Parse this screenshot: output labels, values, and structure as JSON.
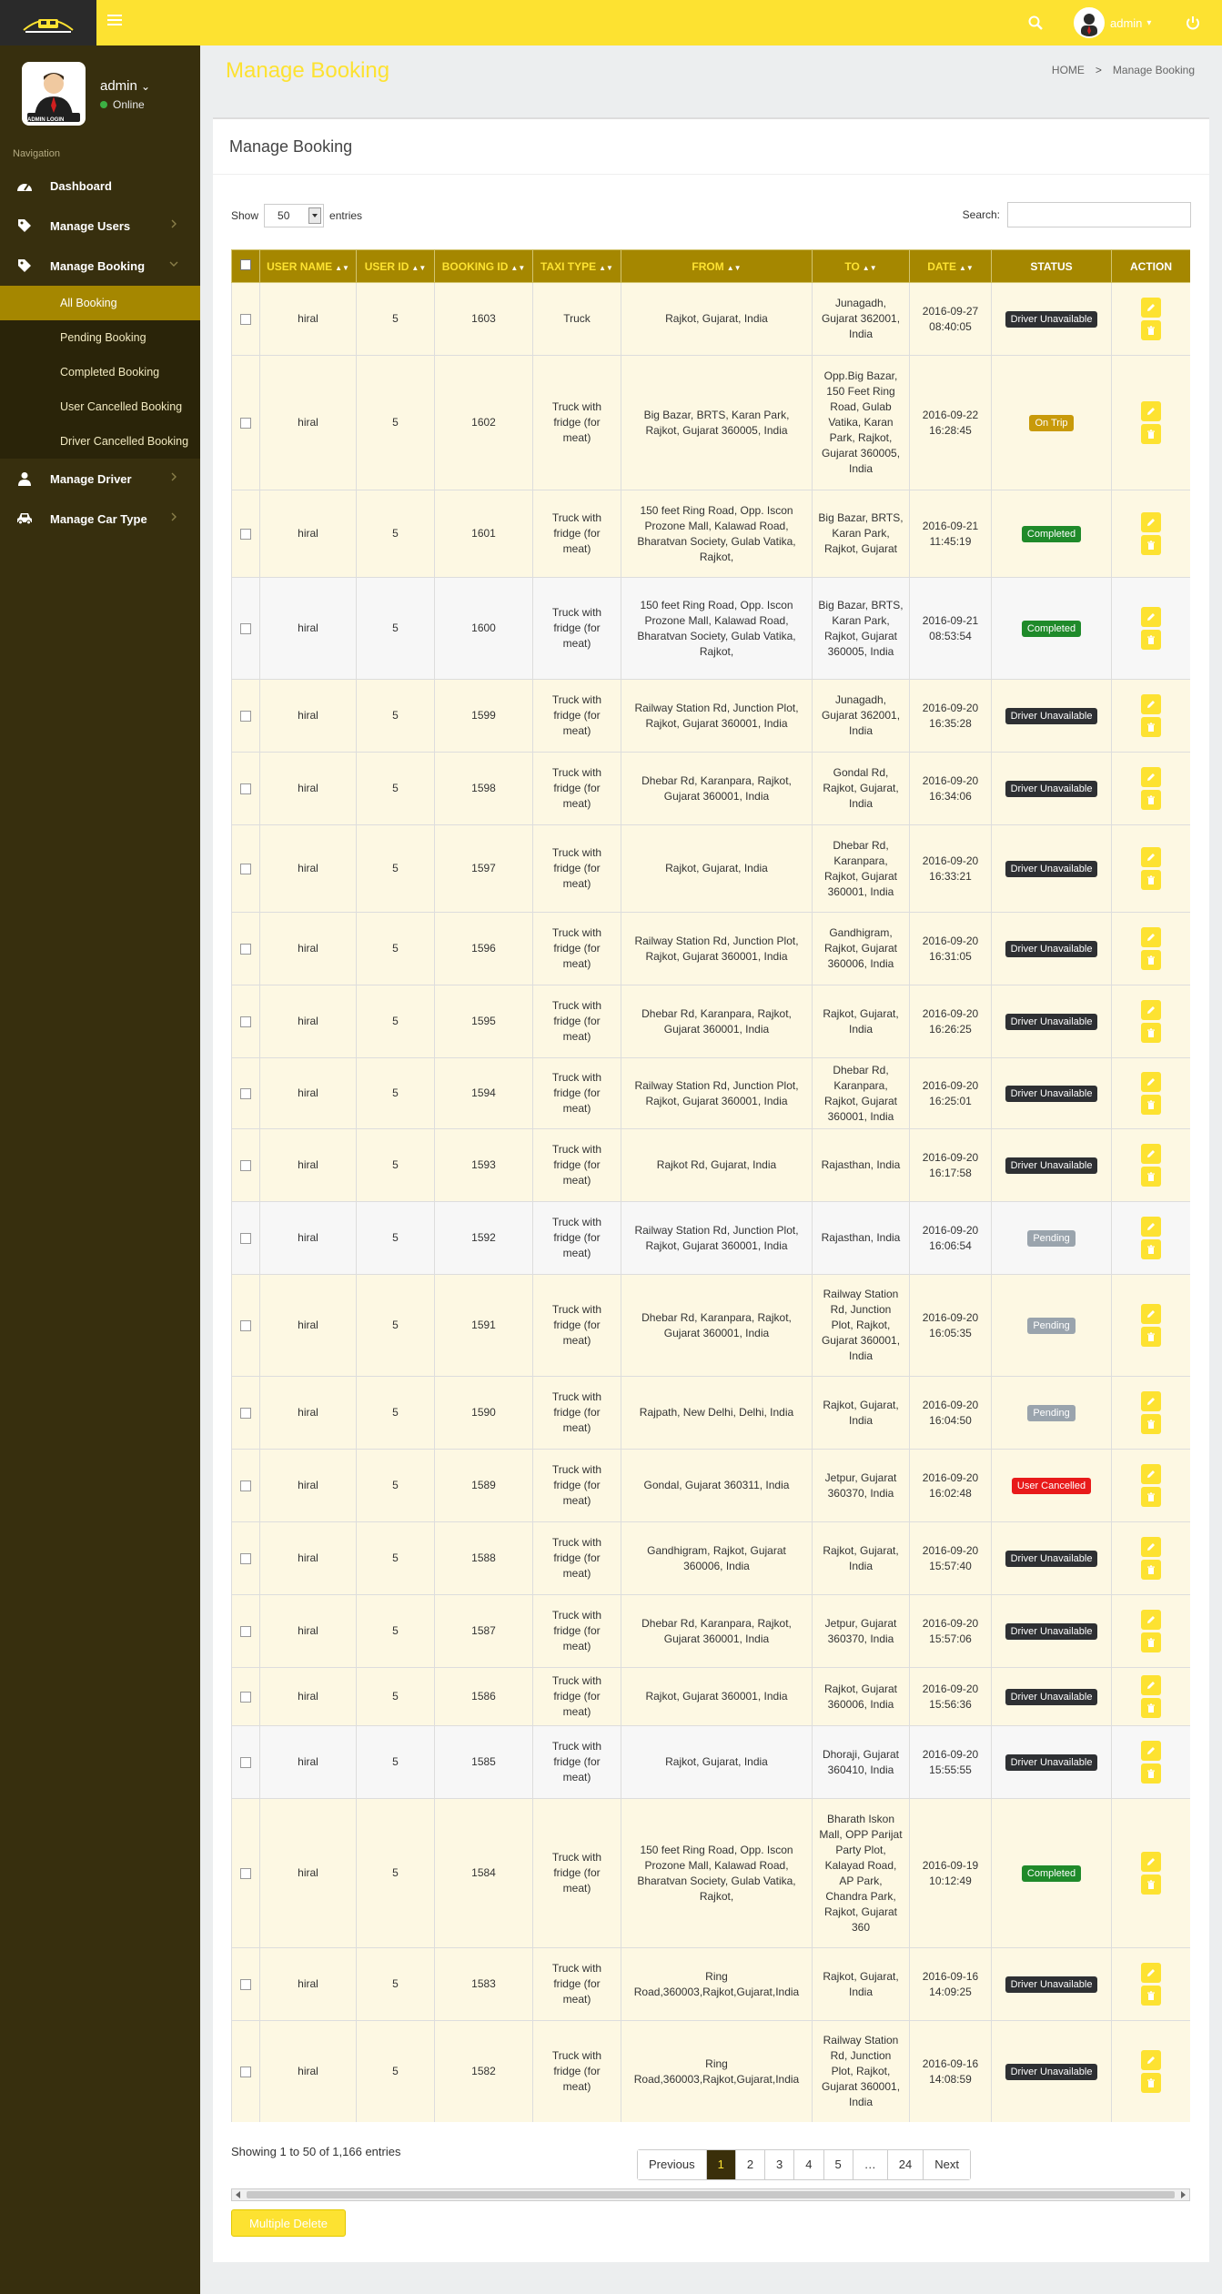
{
  "topbar": {
    "user_label": "admin",
    "user_caret": "▾"
  },
  "sidebar": {
    "profile_name": "admin",
    "profile_caret": "⌄",
    "profile_status": "Online",
    "badge_text": "ADMIN LOGIN",
    "nav_heading": "Navigation",
    "items": [
      {
        "label": "Dashboard",
        "icon": "dashboard-icon"
      },
      {
        "label": "Manage Users",
        "icon": "tag-icon"
      },
      {
        "label": "Manage Booking",
        "icon": "tag-icon"
      },
      {
        "label": "Manage Driver",
        "icon": "user-icon"
      },
      {
        "label": "Manage Car Type",
        "icon": "car-icon"
      }
    ],
    "sub_items": [
      "All Booking",
      "Pending Booking",
      "Completed Booking",
      "User Cancelled Booking",
      "Driver Cancelled Booking"
    ]
  },
  "header": {
    "title": "Manage Booking",
    "crumb_home": "HOME",
    "crumb_sep": ">",
    "crumb_current": "Manage Booking"
  },
  "box": {
    "title": "Manage Booking"
  },
  "controls": {
    "show_label": "Show",
    "entries_value": "50",
    "entries_label": "entries",
    "search_label": "Search:",
    "search_value": ""
  },
  "table": {
    "columns": [
      "USER NAME",
      "USER ID",
      "BOOKING ID",
      "TAXI TYPE",
      "FROM",
      "TO",
      "DATE",
      "STATUS",
      "ACTION"
    ],
    "rows": [
      {
        "user": "hiral",
        "uid": "5",
        "bid": "1603",
        "taxi": "Truck",
        "from": "Rajkot, Gujarat, India",
        "to": "Junagadh, Gujarat 362001, India",
        "date": "2016-09-27 08:40:05",
        "status": "Driver Unavailable"
      },
      {
        "user": "hiral",
        "uid": "5",
        "bid": "1602",
        "taxi": "Truck with fridge (for meat)",
        "from": "Big Bazar, BRTS, Karan Park, Rajkot, Gujarat 360005, India",
        "to": "Opp.Big Bazar, 150 Feet Ring Road, Gulab Vatika, Karan Park, Rajkot, Gujarat 360005, India",
        "date": "2016-09-22 16:28:45",
        "status": "On Trip"
      },
      {
        "user": "hiral",
        "uid": "5",
        "bid": "1601",
        "taxi": "Truck with fridge (for meat)",
        "from": "150 feet Ring Road, Opp. Iscon Prozone Mall, Kalawad Road, Bharatvan Society, Gulab Vatika, Rajkot,",
        "to": "Big Bazar, BRTS, Karan Park, Rajkot, Gujarat",
        "date": "2016-09-21 11:45:19",
        "status": "Completed"
      },
      {
        "user": "hiral",
        "uid": "5",
        "bid": "1600",
        "taxi": "Truck with fridge (for meat)",
        "from": "150 feet Ring Road, Opp. Iscon Prozone Mall, Kalawad Road, Bharatvan Society, Gulab Vatika, Rajkot,",
        "to": "Big Bazar, BRTS, Karan Park, Rajkot, Gujarat 360005, India",
        "date": "2016-09-21 08:53:54",
        "status": "Completed"
      },
      {
        "user": "hiral",
        "uid": "5",
        "bid": "1599",
        "taxi": "Truck with fridge (for meat)",
        "from": "Railway Station Rd, Junction Plot, Rajkot, Gujarat 360001, India",
        "to": "Junagadh, Gujarat 362001, India",
        "date": "2016-09-20 16:35:28",
        "status": "Driver Unavailable"
      },
      {
        "user": "hiral",
        "uid": "5",
        "bid": "1598",
        "taxi": "Truck with fridge (for meat)",
        "from": "Dhebar Rd, Karanpara, Rajkot, Gujarat 360001, India",
        "to": "Gondal Rd, Rajkot, Gujarat, India",
        "date": "2016-09-20 16:34:06",
        "status": "Driver Unavailable"
      },
      {
        "user": "hiral",
        "uid": "5",
        "bid": "1597",
        "taxi": "Truck with fridge (for meat)",
        "from": "Rajkot, Gujarat, India",
        "to": "Dhebar Rd, Karanpara, Rajkot, Gujarat 360001, India",
        "date": "2016-09-20 16:33:21",
        "status": "Driver Unavailable"
      },
      {
        "user": "hiral",
        "uid": "5",
        "bid": "1596",
        "taxi": "Truck with fridge (for meat)",
        "from": "Railway Station Rd, Junction Plot, Rajkot, Gujarat 360001, India",
        "to": "Gandhigram, Rajkot, Gujarat 360006, India",
        "date": "2016-09-20 16:31:05",
        "status": "Driver Unavailable"
      },
      {
        "user": "hiral",
        "uid": "5",
        "bid": "1595",
        "taxi": "Truck with fridge (for meat)",
        "from": "Dhebar Rd, Karanpara, Rajkot, Gujarat 360001, India",
        "to": "Rajkot, Gujarat, India",
        "date": "2016-09-20 16:26:25",
        "status": "Driver Unavailable"
      },
      {
        "user": "hiral",
        "uid": "5",
        "bid": "1594",
        "taxi": "Truck with fridge (for meat)",
        "from": "Railway Station Rd, Junction Plot, Rajkot, Gujarat 360001, India",
        "to": "Dhebar Rd, Karanpara, Rajkot, Gujarat 360001, India",
        "date": "2016-09-20 16:25:01",
        "status": "Driver Unavailable"
      },
      {
        "user": "hiral",
        "uid": "5",
        "bid": "1593",
        "taxi": "Truck with fridge (for meat)",
        "from": "Rajkot Rd, Gujarat, India",
        "to": "Rajasthan, India",
        "date": "2016-09-20 16:17:58",
        "status": "Driver Unavailable"
      },
      {
        "user": "hiral",
        "uid": "5",
        "bid": "1592",
        "taxi": "Truck with fridge (for meat)",
        "from": "Railway Station Rd, Junction Plot, Rajkot, Gujarat 360001, India",
        "to": "Rajasthan, India",
        "date": "2016-09-20 16:06:54",
        "status": "Pending"
      },
      {
        "user": "hiral",
        "uid": "5",
        "bid": "1591",
        "taxi": "Truck with fridge (for meat)",
        "from": "Dhebar Rd, Karanpara, Rajkot, Gujarat 360001, India",
        "to": "Railway Station Rd, Junction Plot, Rajkot, Gujarat 360001, India",
        "date": "2016-09-20 16:05:35",
        "status": "Pending"
      },
      {
        "user": "hiral",
        "uid": "5",
        "bid": "1590",
        "taxi": "Truck with fridge (for meat)",
        "from": "Rajpath, New Delhi, Delhi, India",
        "to": "Rajkot, Gujarat, India",
        "date": "2016-09-20 16:04:50",
        "status": "Pending"
      },
      {
        "user": "hiral",
        "uid": "5",
        "bid": "1589",
        "taxi": "Truck with fridge (for meat)",
        "from": "Gondal, Gujarat 360311, India",
        "to": "Jetpur, Gujarat 360370, India",
        "date": "2016-09-20 16:02:48",
        "status": "User Cancelled"
      },
      {
        "user": "hiral",
        "uid": "5",
        "bid": "1588",
        "taxi": "Truck with fridge (for meat)",
        "from": "Gandhigram, Rajkot, Gujarat 360006, India",
        "to": "Rajkot, Gujarat, India",
        "date": "2016-09-20 15:57:40",
        "status": "Driver Unavailable"
      },
      {
        "user": "hiral",
        "uid": "5",
        "bid": "1587",
        "taxi": "Truck with fridge (for meat)",
        "from": "Dhebar Rd, Karanpara, Rajkot, Gujarat 360001, India",
        "to": "Jetpur, Gujarat 360370, India",
        "date": "2016-09-20 15:57:06",
        "status": "Driver Unavailable"
      },
      {
        "user": "hiral",
        "uid": "5",
        "bid": "1586",
        "taxi": "Truck with fridge (for meat)",
        "from": "Rajkot, Gujarat 360001, India",
        "to": "Rajkot, Gujarat 360006, India",
        "date": "2016-09-20 15:56:36",
        "status": "Driver Unavailable"
      },
      {
        "user": "hiral",
        "uid": "5",
        "bid": "1585",
        "taxi": "Truck with fridge (for meat)",
        "from": "Rajkot, Gujarat, India",
        "to": "Dhoraji, Gujarat 360410, India",
        "date": "2016-09-20 15:55:55",
        "status": "Driver Unavailable"
      },
      {
        "user": "hiral",
        "uid": "5",
        "bid": "1584",
        "taxi": "Truck with fridge (for meat)",
        "from": "150 feet Ring Road, Opp. Iscon Prozone Mall, Kalawad Road, Bharatvan Society, Gulab Vatika, Rajkot,",
        "to": "Bharath Iskon Mall, OPP Parijat Party Plot, Kalayad Road, AP Park, Chandra Park, Rajkot, Gujarat 360",
        "date": "2016-09-19 10:12:49",
        "status": "Completed"
      },
      {
        "user": "hiral",
        "uid": "5",
        "bid": "1583",
        "taxi": "Truck with fridge (for meat)",
        "from": "Ring Road,360003,Rajkot,Gujarat,India",
        "to": "Rajkot, Gujarat, India",
        "date": "2016-09-16 14:09:25",
        "status": "Driver Unavailable"
      },
      {
        "user": "hiral",
        "uid": "5",
        "bid": "1582",
        "taxi": "Truck with fridge (for meat)",
        "from": "Ring Road,360003,Rajkot,Gujarat,India",
        "to": "Railway Station Rd, Junction Plot, Rajkot, Gujarat 360001, India",
        "date": "2016-09-16 14:08:59",
        "status": "Driver Unavailable"
      }
    ]
  },
  "footer": {
    "info": "Showing 1 to 50 of 1,166 entries",
    "pages": [
      "Previous",
      "1",
      "2",
      "3",
      "4",
      "5",
      "…",
      "24",
      "Next"
    ],
    "active_page": "1",
    "multi_delete": "Multiple Delete"
  },
  "colors": {
    "accent": "#fde231",
    "sidebar": "#372f0e",
    "header_row": "#a58700"
  }
}
